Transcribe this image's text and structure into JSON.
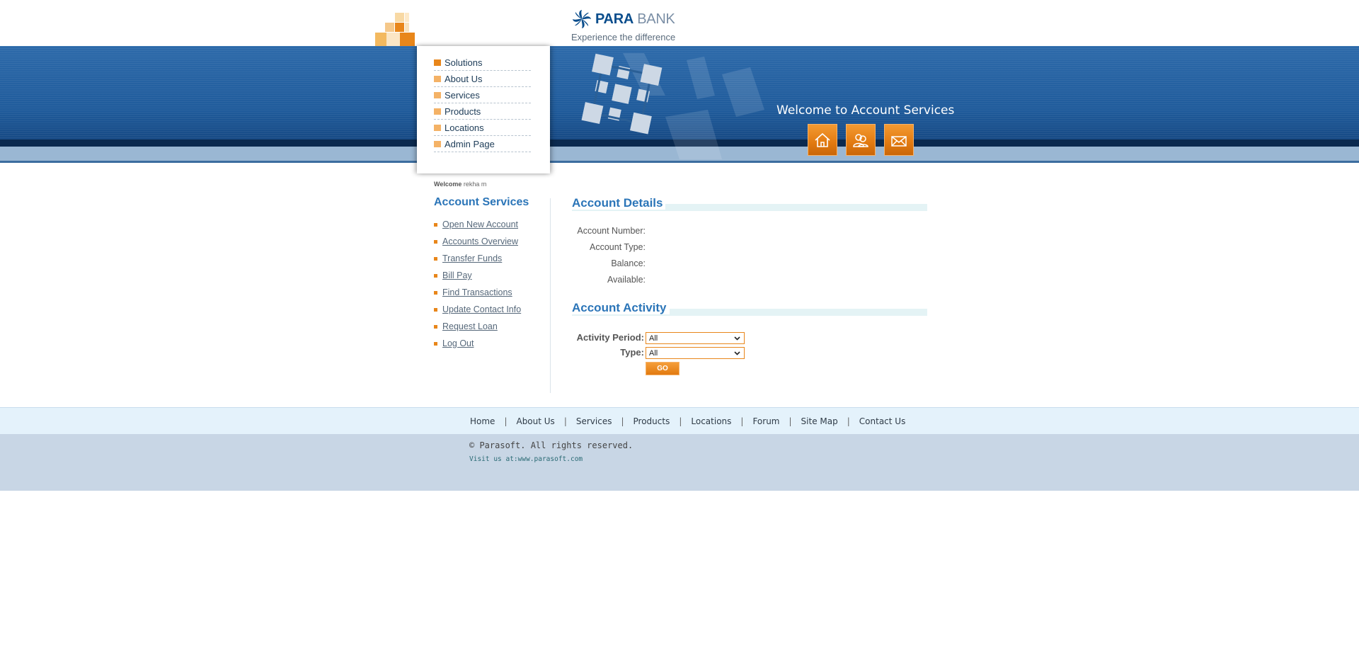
{
  "brand": {
    "name_part1": "PARA",
    "name_part2": "BANK",
    "tagline": "Experience the difference",
    "primary_color": "#0a4d8c",
    "accent_color": "#e8861a"
  },
  "top_menu": {
    "items": [
      {
        "label": "Solutions",
        "active": true
      },
      {
        "label": "About Us"
      },
      {
        "label": "Services"
      },
      {
        "label": "Products"
      },
      {
        "label": "Locations"
      },
      {
        "label": "Admin Page"
      }
    ]
  },
  "banner": {
    "heading": "Welcome to Account Services",
    "buttons": [
      {
        "icon": "home-icon"
      },
      {
        "icon": "contact-people-icon"
      },
      {
        "icon": "mail-icon"
      }
    ]
  },
  "sidebar": {
    "welcome_prefix": "Welcome",
    "user_name": "rekha m",
    "title": "Account Services",
    "links": [
      {
        "label": "Open New Account"
      },
      {
        "label": "Accounts Overview"
      },
      {
        "label": "Transfer Funds"
      },
      {
        "label": "Bill Pay"
      },
      {
        "label": "Find Transactions"
      },
      {
        "label": "Update Contact Info"
      },
      {
        "label": "Request Loan"
      },
      {
        "label": "Log Out"
      }
    ]
  },
  "account_details": {
    "title": "Account Details",
    "fields": [
      {
        "label": "Account Number:",
        "value": ""
      },
      {
        "label": "Account Type:",
        "value": ""
      },
      {
        "label": "Balance:",
        "value": ""
      },
      {
        "label": "Available:",
        "value": ""
      }
    ]
  },
  "account_activity": {
    "title": "Account Activity",
    "period_label": "Activity Period:",
    "period_value": "All",
    "type_label": "Type:",
    "type_value": "All",
    "go_label": "GO"
  },
  "footer": {
    "links": [
      "Home",
      "About Us",
      "Services",
      "Products",
      "Locations",
      "Forum",
      "Site Map",
      "Contact Us"
    ],
    "copyright": "© Parasoft. All rights reserved.",
    "visit_prefix": "Visit us at:",
    "visit_link": "www.parasoft.com"
  }
}
